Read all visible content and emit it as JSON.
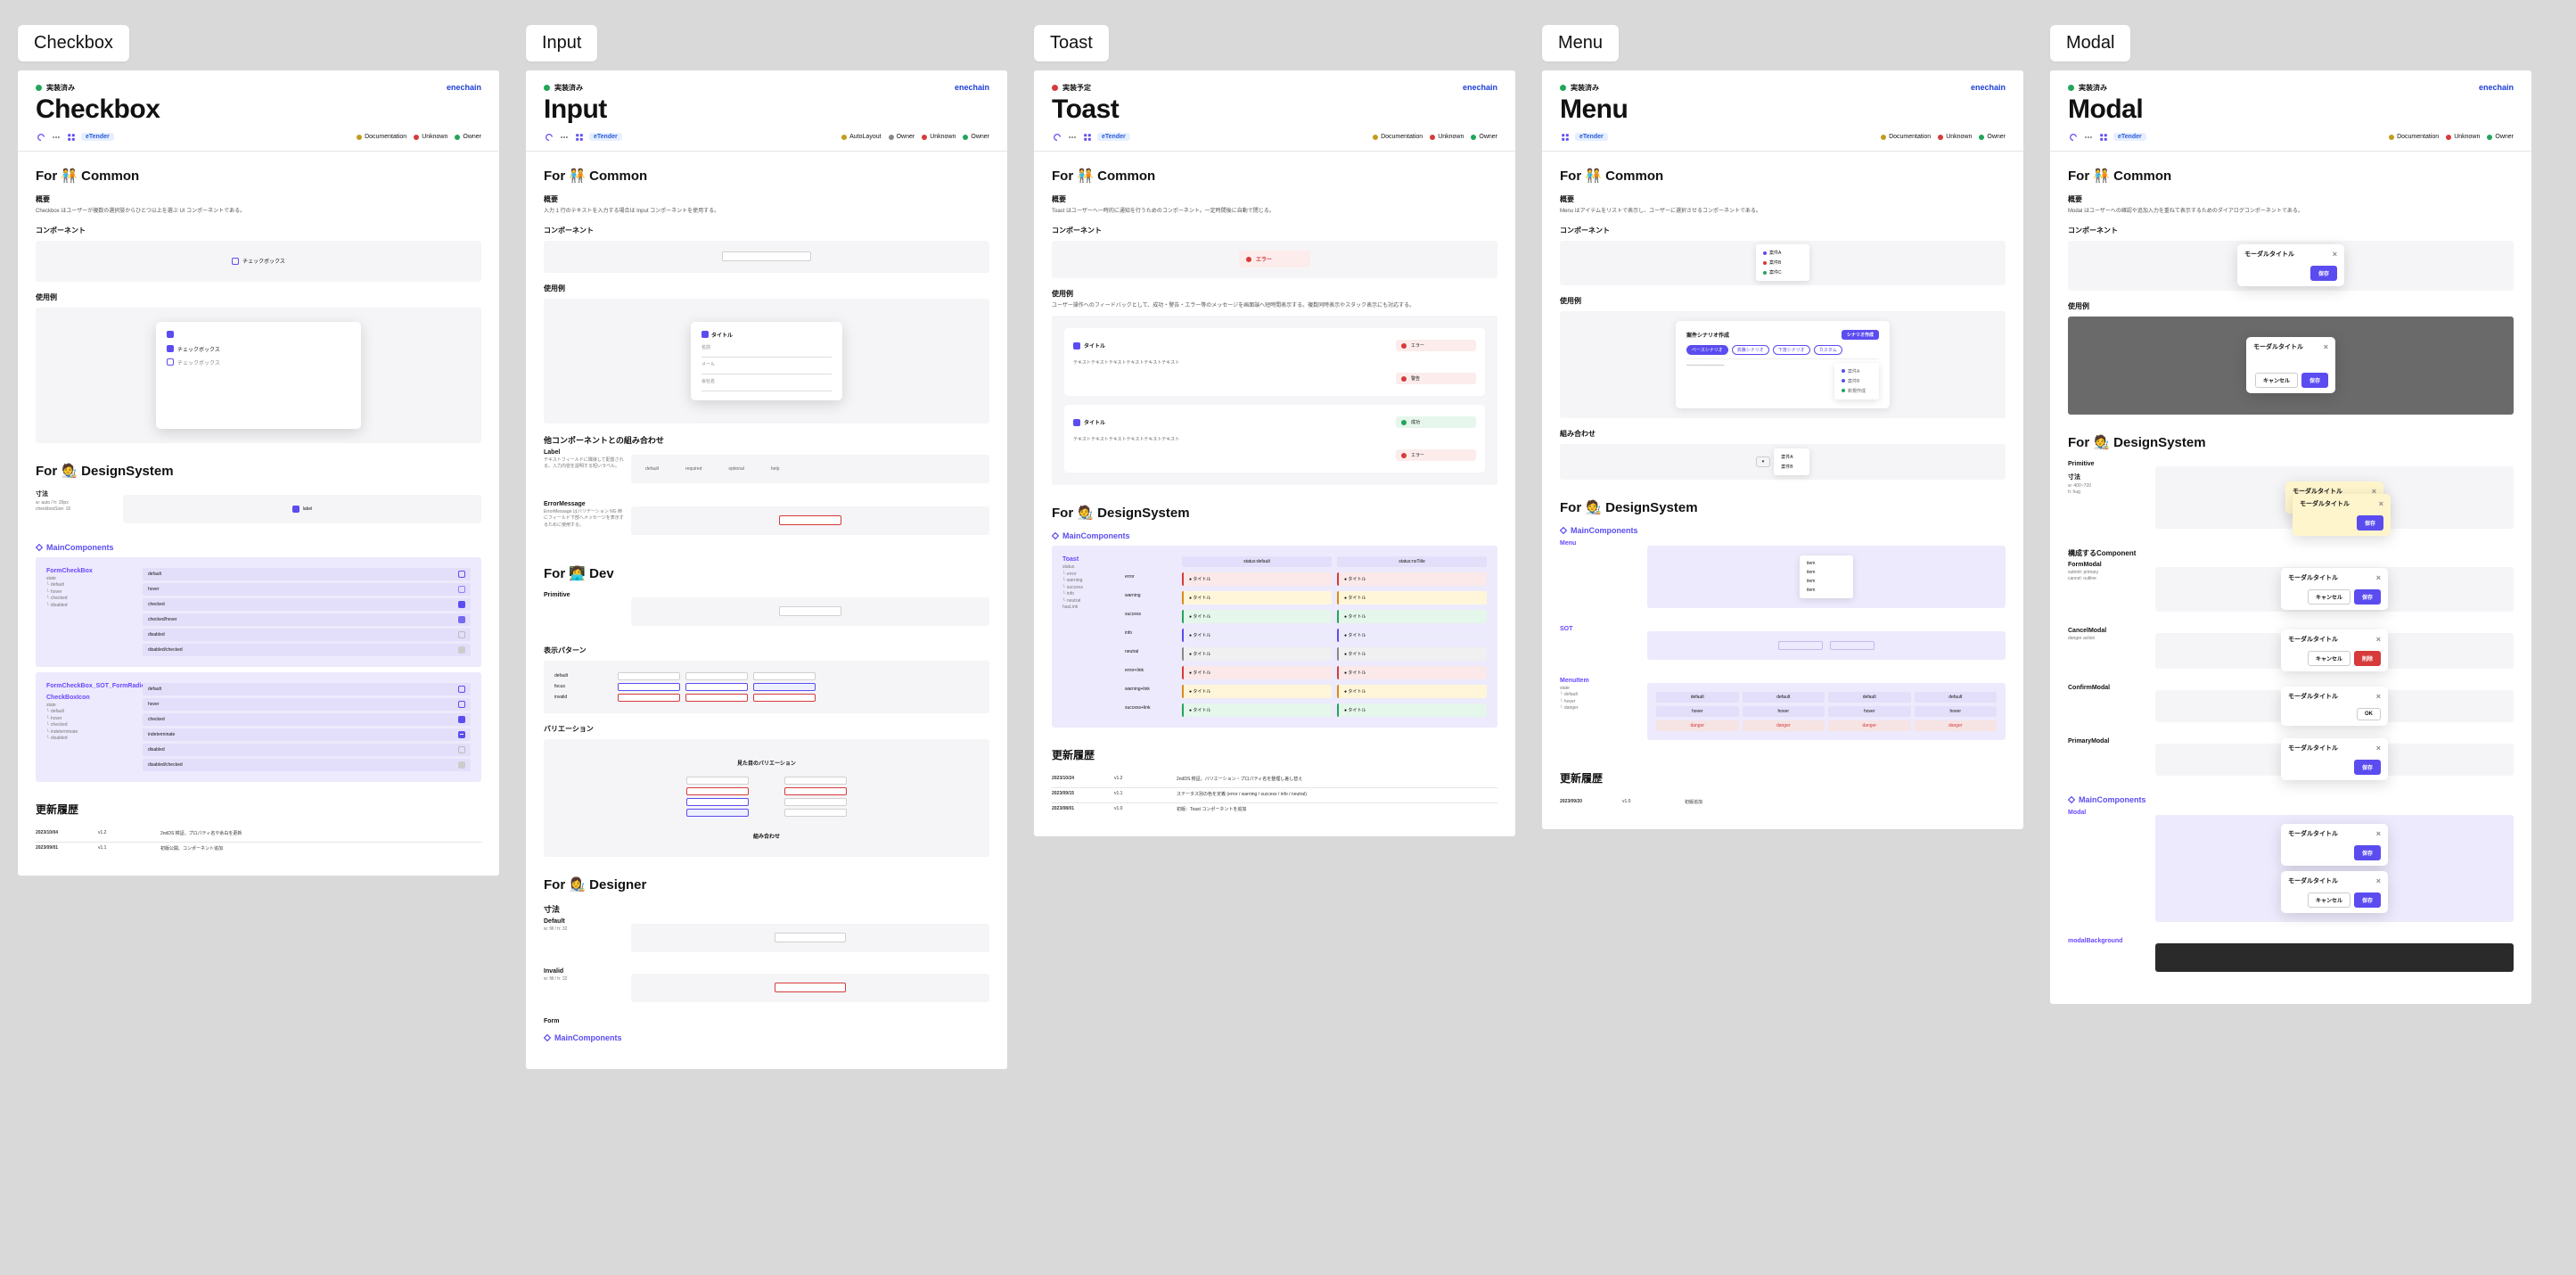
{
  "brand": "enechain",
  "etender": "eTender",
  "sections": {
    "common": "For 🧑‍🤝‍🧑 Common",
    "design": "For 🧑‍🎨 DesignSystem",
    "dev": "For 👩‍💻 Dev",
    "designer": "For 👩‍🎨 Designer"
  },
  "sub": {
    "overview": "概要",
    "component": "コンポーネント",
    "usage": "使用例",
    "dim": "寸法",
    "combo": "他コンポーネントとの組み合わせ",
    "history": "更新履歴",
    "label": "Label",
    "errmsg": "ErrorMessage",
    "primitive": "Primitive",
    "patterns": "表示パターン",
    "variation": "バリエーション",
    "pair": "組み合わせ",
    "segments": "構成するComponent",
    "link": "MainComponents"
  },
  "tools": {
    "autolayout": "AutoLayout",
    "unknown": "Unknown",
    "owner": "Owner",
    "documentation": "Documentation"
  },
  "checkbox": {
    "tag": "Checkbox",
    "title": "Checkbox",
    "status": "実装済み",
    "overview": "Checkbox はユーザーが複数の選択肢からひとつ以上を選ぶ UI コンポーネントである。",
    "sample_label": "チェックボックス",
    "ds": {
      "item1": "FormCheckBox",
      "item2": "FormCheckBox_SOT_FormRadioButton",
      "item3": "CheckBoxIcon"
    },
    "history": [
      [
        "2023/10/04",
        "v1.2",
        "2ndDS 検証。プロパティ名や余白を更新"
      ],
      [
        "2023/09/01",
        "v1.1",
        "初版公開、コンポーネント追加"
      ]
    ]
  },
  "input": {
    "tag": "Input",
    "title": "Input",
    "status": "実装済み",
    "overview": "入力 1 行のテキストを入力する場合は Input コンポーネントを使用する。",
    "usage_title": "タイトル",
    "fields": [
      "名前",
      "メール",
      "会社名"
    ],
    "label_desc": "テキストフィールドに隣接して配置される。入力内容を説明する短いラベル。",
    "err_desc": "ErrorMessage はバリデーション NG 時にフィールド下部へメッセージを表示するために使用する。",
    "variation_title": "見た目のバリエーション",
    "default": "Default",
    "invalid": "Invalid",
    "form": "Form"
  },
  "toast": {
    "tag": "Toast",
    "title": "Toast",
    "status": "実装予定",
    "overview": "Toast はユーザーへ一時的に通知を行うためのコンポーネント。一定時間後に自動で閉じる。",
    "usage_desc": "ユーザー操作へのフィードバックとして、成功・警告・エラー等のメッセージを画面端へ短時間表示する。複数同時表示やスタック表示にも対応する。",
    "card_title": "タイトル",
    "card_text": "テキストテキストテキストテキストテキストテキスト",
    "error": "エラー",
    "warning": "警告",
    "success": "成功",
    "ds_name": "Toast",
    "cols": [
      "status:default",
      "status:noTitle"
    ],
    "rows": [
      "error",
      "warning",
      "success",
      "info",
      "neutral",
      "error+link",
      "warning+link",
      "success+link"
    ],
    "history": [
      [
        "2023/10/24",
        "v1.2",
        "2ndDS 検証。バリエーション・プロパティ名を整理し差し替え"
      ],
      [
        "2023/09/15",
        "v1.1",
        "ステータス別の色を定義 (error / warning / success / info / neutral)"
      ],
      [
        "2023/08/01",
        "v1.0",
        "初版：Toast コンポーネントを追加"
      ]
    ]
  },
  "menu": {
    "tag": "Menu",
    "title": "Menu",
    "status": "実装済み",
    "overview": "Menu はアイテムをリストで表示し、ユーザーに選択させるコンポーネントである。",
    "demo_title": "案件シナリオ作成",
    "demo_btn": "シナリオ作成",
    "tags": [
      "ベースシナリオ",
      "高騰シナリオ",
      "下落シナリオ",
      "カスタム"
    ],
    "items": [
      "案件A",
      "案件B",
      "案件C",
      "新規作成"
    ],
    "combo": "組み合わせ",
    "ds": {
      "menu": "Menu",
      "sot": "SOT",
      "menuitem": "MenuItem"
    },
    "history": [
      [
        "2023/09/20",
        "v1.0",
        "初版追加"
      ]
    ]
  },
  "modal": {
    "tag": "Modal",
    "title": "Modal",
    "status": "実装済み",
    "overview": "Modal はユーザーへの確認や追加入力を重ねて表示するためのダイアログコンポーネントである。",
    "m_title": "モーダルタイトル",
    "ok": "保存",
    "cancel": "キャンセル",
    "delete": "削除",
    "confirm": "OK",
    "ds": {
      "primitive": "Primitive",
      "form": "FormModal",
      "cancel": "CancelModal",
      "confirm": "ConfirmModal",
      "primary": "PrimaryModal",
      "modal": "Modal",
      "bg": "modalBackground"
    }
  }
}
